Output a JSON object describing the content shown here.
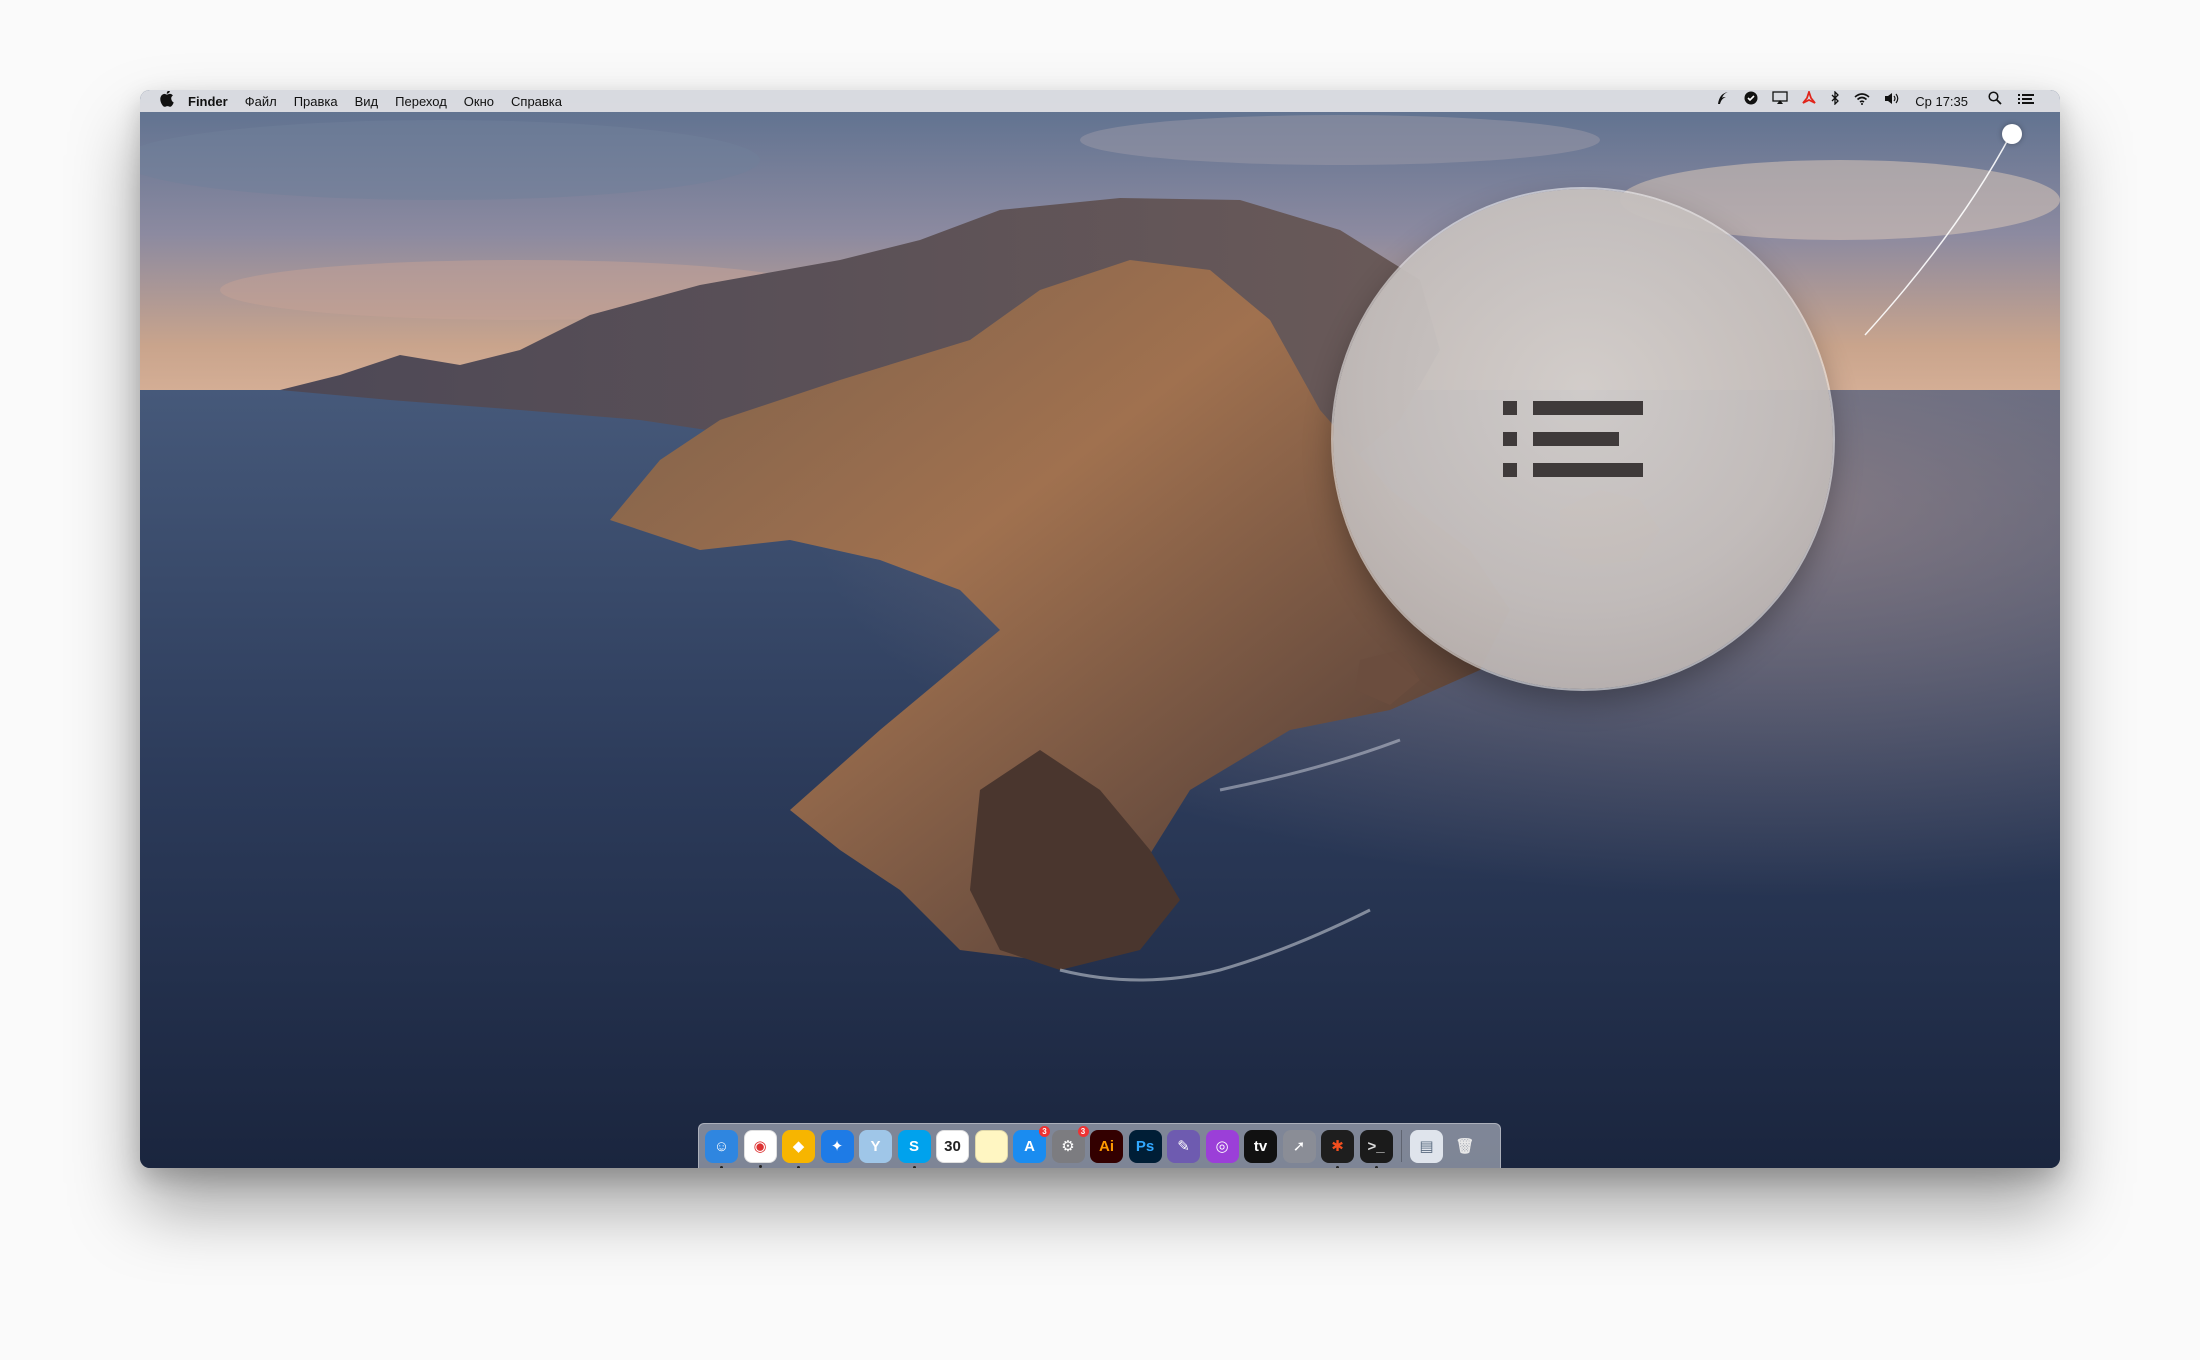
{
  "menubar": {
    "apple_icon": "apple-logo-icon",
    "app_name": "Finder",
    "menus": [
      "Файл",
      "Правка",
      "Вид",
      "Переход",
      "Окно",
      "Справка"
    ],
    "status_icons": [
      "feather-icon",
      "check-shield-icon",
      "airplay-icon",
      "acrobat-icon",
      "bluetooth-icon",
      "wifi-icon",
      "volume-icon"
    ],
    "clock": "Ср 17:35",
    "search_icon": "spotlight-search-icon",
    "notification_icon": "notification-center-icon"
  },
  "magnifier": {
    "icon": "notification-center-list-icon",
    "color": "#3f3a3a"
  },
  "dock": {
    "apps": [
      {
        "name": "finder-icon",
        "bg": "#2f86e0",
        "glyph": "☺",
        "running": true
      },
      {
        "name": "chrome-icon",
        "bg": "#ffffff",
        "glyph": "◉",
        "fg": "#d33",
        "running": true
      },
      {
        "name": "sketch-icon",
        "bg": "#f7b500",
        "glyph": "◆",
        "fg": "#fff",
        "running": true
      },
      {
        "name": "safari-icon",
        "bg": "#1e7be6",
        "glyph": "✦",
        "running": false
      },
      {
        "name": "tweetbot-icon",
        "bg": "#9fc6e8",
        "glyph": "Y",
        "running": false
      },
      {
        "name": "skype-icon",
        "bg": "#00a2ed",
        "glyph": "S",
        "running": true
      },
      {
        "name": "calendar-icon",
        "bg": "#ffffff",
        "glyph": "30",
        "fg": "#222",
        "running": false
      },
      {
        "name": "notes-icon",
        "bg": "#fff6c2",
        "glyph": "",
        "running": false
      },
      {
        "name": "app-store-icon",
        "bg": "#1a8cf0",
        "glyph": "A",
        "badge": "3",
        "running": false
      },
      {
        "name": "system-preferences-icon",
        "bg": "#7c7c80",
        "glyph": "⚙",
        "badge": "3",
        "running": false
      },
      {
        "name": "illustrator-icon",
        "bg": "#330000",
        "glyph": "Ai",
        "fg": "#ff9a00",
        "running": false
      },
      {
        "name": "photoshop-icon",
        "bg": "#001e36",
        "glyph": "Ps",
        "fg": "#31a8ff",
        "running": false
      },
      {
        "name": "quill-icon",
        "bg": "#6e5bb0",
        "glyph": "✎",
        "running": false
      },
      {
        "name": "podcasts-icon",
        "bg": "#9b3fd8",
        "glyph": "◎",
        "running": false
      },
      {
        "name": "apple-tv-icon",
        "bg": "#111111",
        "glyph": "tv",
        "running": false
      },
      {
        "name": "launchpad-icon",
        "bg": "#8a8d96",
        "glyph": "➚",
        "running": false
      },
      {
        "name": "figma-icon",
        "bg": "#1e1e1e",
        "glyph": "✱",
        "fg": "#f24e1e",
        "running": true
      },
      {
        "name": "terminal-icon",
        "bg": "#1b1b1b",
        "glyph": ">_",
        "fg": "#ddd",
        "running": true
      }
    ],
    "trailing": [
      {
        "name": "downloads-stack-icon",
        "bg": "#dfe4ec",
        "glyph": "▤",
        "fg": "#5a6b80"
      },
      {
        "name": "trash-icon",
        "bg": "transparent",
        "glyph": "🗑",
        "fg": "#e8e8e8"
      }
    ]
  }
}
